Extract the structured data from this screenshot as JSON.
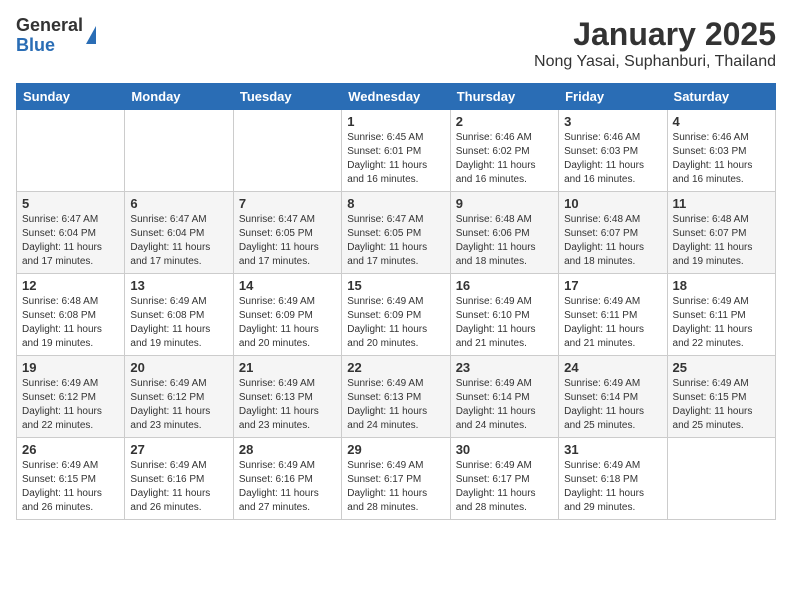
{
  "logo": {
    "general": "General",
    "blue": "Blue"
  },
  "title": "January 2025",
  "location": "Nong Yasai, Suphanburi, Thailand",
  "weekdays": [
    "Sunday",
    "Monday",
    "Tuesday",
    "Wednesday",
    "Thursday",
    "Friday",
    "Saturday"
  ],
  "weeks": [
    [
      {
        "day": "",
        "info": ""
      },
      {
        "day": "",
        "info": ""
      },
      {
        "day": "",
        "info": ""
      },
      {
        "day": "1",
        "info": "Sunrise: 6:45 AM\nSunset: 6:01 PM\nDaylight: 11 hours and 16 minutes."
      },
      {
        "day": "2",
        "info": "Sunrise: 6:46 AM\nSunset: 6:02 PM\nDaylight: 11 hours and 16 minutes."
      },
      {
        "day": "3",
        "info": "Sunrise: 6:46 AM\nSunset: 6:03 PM\nDaylight: 11 hours and 16 minutes."
      },
      {
        "day": "4",
        "info": "Sunrise: 6:46 AM\nSunset: 6:03 PM\nDaylight: 11 hours and 16 minutes."
      }
    ],
    [
      {
        "day": "5",
        "info": "Sunrise: 6:47 AM\nSunset: 6:04 PM\nDaylight: 11 hours and 17 minutes."
      },
      {
        "day": "6",
        "info": "Sunrise: 6:47 AM\nSunset: 6:04 PM\nDaylight: 11 hours and 17 minutes."
      },
      {
        "day": "7",
        "info": "Sunrise: 6:47 AM\nSunset: 6:05 PM\nDaylight: 11 hours and 17 minutes."
      },
      {
        "day": "8",
        "info": "Sunrise: 6:47 AM\nSunset: 6:05 PM\nDaylight: 11 hours and 17 minutes."
      },
      {
        "day": "9",
        "info": "Sunrise: 6:48 AM\nSunset: 6:06 PM\nDaylight: 11 hours and 18 minutes."
      },
      {
        "day": "10",
        "info": "Sunrise: 6:48 AM\nSunset: 6:07 PM\nDaylight: 11 hours and 18 minutes."
      },
      {
        "day": "11",
        "info": "Sunrise: 6:48 AM\nSunset: 6:07 PM\nDaylight: 11 hours and 19 minutes."
      }
    ],
    [
      {
        "day": "12",
        "info": "Sunrise: 6:48 AM\nSunset: 6:08 PM\nDaylight: 11 hours and 19 minutes."
      },
      {
        "day": "13",
        "info": "Sunrise: 6:49 AM\nSunset: 6:08 PM\nDaylight: 11 hours and 19 minutes."
      },
      {
        "day": "14",
        "info": "Sunrise: 6:49 AM\nSunset: 6:09 PM\nDaylight: 11 hours and 20 minutes."
      },
      {
        "day": "15",
        "info": "Sunrise: 6:49 AM\nSunset: 6:09 PM\nDaylight: 11 hours and 20 minutes."
      },
      {
        "day": "16",
        "info": "Sunrise: 6:49 AM\nSunset: 6:10 PM\nDaylight: 11 hours and 21 minutes."
      },
      {
        "day": "17",
        "info": "Sunrise: 6:49 AM\nSunset: 6:11 PM\nDaylight: 11 hours and 21 minutes."
      },
      {
        "day": "18",
        "info": "Sunrise: 6:49 AM\nSunset: 6:11 PM\nDaylight: 11 hours and 22 minutes."
      }
    ],
    [
      {
        "day": "19",
        "info": "Sunrise: 6:49 AM\nSunset: 6:12 PM\nDaylight: 11 hours and 22 minutes."
      },
      {
        "day": "20",
        "info": "Sunrise: 6:49 AM\nSunset: 6:12 PM\nDaylight: 11 hours and 23 minutes."
      },
      {
        "day": "21",
        "info": "Sunrise: 6:49 AM\nSunset: 6:13 PM\nDaylight: 11 hours and 23 minutes."
      },
      {
        "day": "22",
        "info": "Sunrise: 6:49 AM\nSunset: 6:13 PM\nDaylight: 11 hours and 24 minutes."
      },
      {
        "day": "23",
        "info": "Sunrise: 6:49 AM\nSunset: 6:14 PM\nDaylight: 11 hours and 24 minutes."
      },
      {
        "day": "24",
        "info": "Sunrise: 6:49 AM\nSunset: 6:14 PM\nDaylight: 11 hours and 25 minutes."
      },
      {
        "day": "25",
        "info": "Sunrise: 6:49 AM\nSunset: 6:15 PM\nDaylight: 11 hours and 25 minutes."
      }
    ],
    [
      {
        "day": "26",
        "info": "Sunrise: 6:49 AM\nSunset: 6:15 PM\nDaylight: 11 hours and 26 minutes."
      },
      {
        "day": "27",
        "info": "Sunrise: 6:49 AM\nSunset: 6:16 PM\nDaylight: 11 hours and 26 minutes."
      },
      {
        "day": "28",
        "info": "Sunrise: 6:49 AM\nSunset: 6:16 PM\nDaylight: 11 hours and 27 minutes."
      },
      {
        "day": "29",
        "info": "Sunrise: 6:49 AM\nSunset: 6:17 PM\nDaylight: 11 hours and 28 minutes."
      },
      {
        "day": "30",
        "info": "Sunrise: 6:49 AM\nSunset: 6:17 PM\nDaylight: 11 hours and 28 minutes."
      },
      {
        "day": "31",
        "info": "Sunrise: 6:49 AM\nSunset: 6:18 PM\nDaylight: 11 hours and 29 minutes."
      },
      {
        "day": "",
        "info": ""
      }
    ]
  ]
}
